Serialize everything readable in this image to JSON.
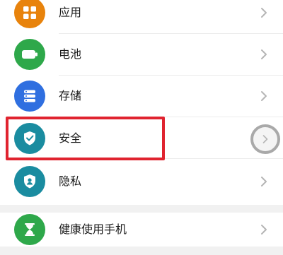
{
  "settings": {
    "items": [
      {
        "label": "应用",
        "icon": "apps-grid-icon",
        "color": "#e8830c"
      },
      {
        "label": "电池",
        "icon": "battery-icon",
        "color": "#2ea84a"
      },
      {
        "label": "存储",
        "icon": "storage-icon",
        "color": "#2f6fe0"
      },
      {
        "label": "安全",
        "icon": "shield-check-icon",
        "color": "#1a8ca0"
      },
      {
        "label": "隐私",
        "icon": "privacy-shield-icon",
        "color": "#1a8ca0"
      }
    ],
    "group2": [
      {
        "label": "健康使用手机",
        "icon": "hourglass-icon",
        "color": "#2ea84a"
      }
    ]
  },
  "annotation": {
    "highlight_color": "#e0232f"
  }
}
